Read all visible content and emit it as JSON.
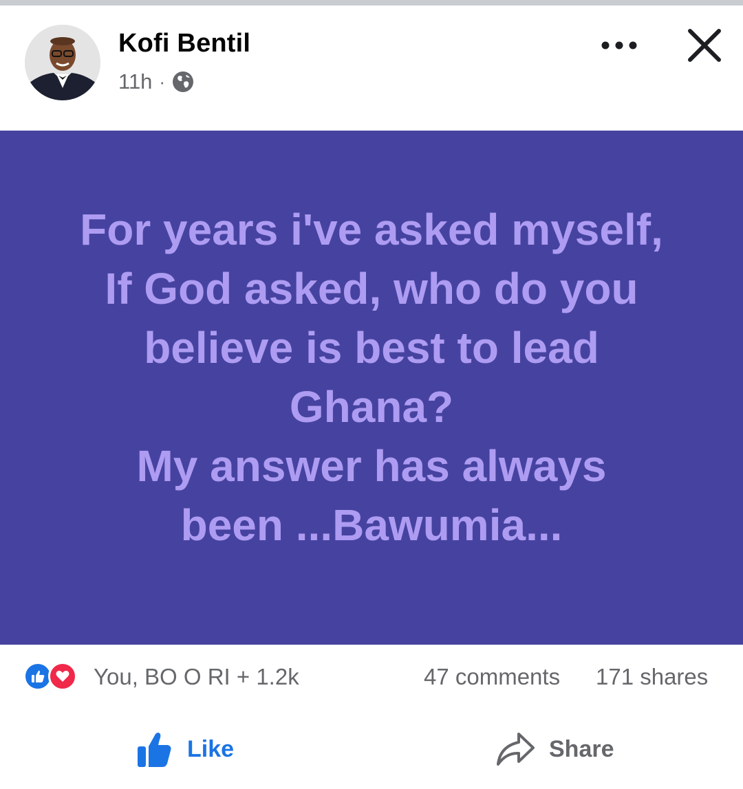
{
  "post": {
    "author": "Kofi Bentil",
    "time": "11h",
    "separator": "·",
    "privacy_icon": "globe-icon",
    "lines": [
      "For years i've asked myself,",
      "If God asked, who do you",
      "believe is best to lead",
      "Ghana?",
      "My answer has always",
      "been ...Bawumia..."
    ],
    "background_color": "#4643a0",
    "text_color": "#ae9cf2"
  },
  "stats": {
    "reaction_icons": [
      "like-reaction-icon",
      "love-reaction-icon"
    ],
    "reactors": "You, BO O RI + 1.2k",
    "comments": "47 comments",
    "shares": "171 shares"
  },
  "actions": {
    "like_label": "Like",
    "share_label": "Share"
  },
  "colors": {
    "brand_blue": "#1b74e4",
    "secondary_text": "#65676b",
    "love_red": "#f02849"
  }
}
